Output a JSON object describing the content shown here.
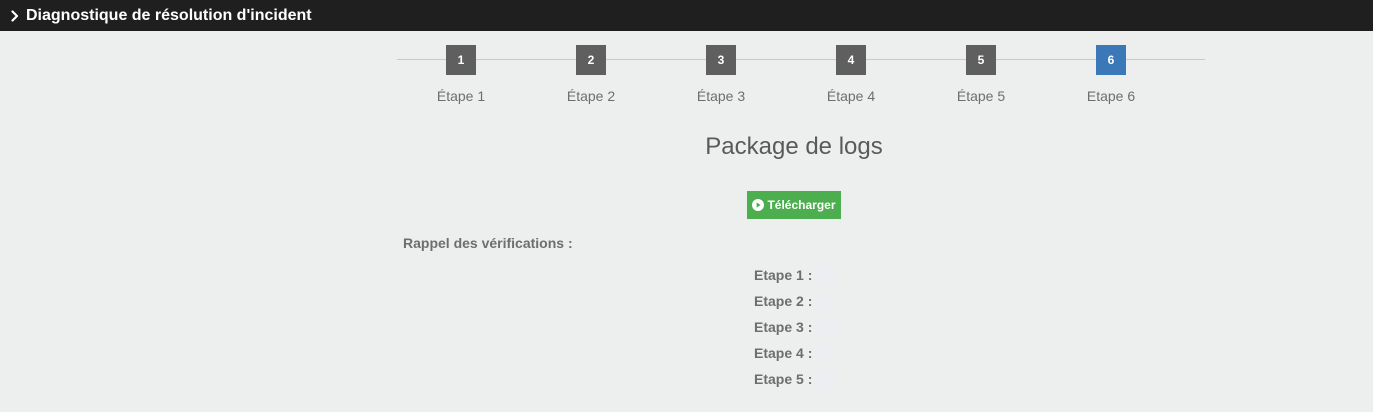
{
  "header": {
    "title": "Diagnostique de résolution d'incident"
  },
  "stepper": {
    "steps": [
      {
        "number": "1",
        "label": "Étape 1",
        "active": false
      },
      {
        "number": "2",
        "label": "Étape 2",
        "active": false
      },
      {
        "number": "3",
        "label": "Étape 3",
        "active": false
      },
      {
        "number": "4",
        "label": "Étape 4",
        "active": false
      },
      {
        "number": "5",
        "label": "Étape 5",
        "active": false
      },
      {
        "number": "6",
        "label": "Etape 6",
        "active": true
      }
    ]
  },
  "main": {
    "title": "Package de logs",
    "download_label": "Télécharger",
    "recap_label": "Rappel des vérifications :",
    "checks": [
      {
        "label": "Etape 1 :"
      },
      {
        "label": "Etape 2 :"
      },
      {
        "label": "Etape 3 :"
      },
      {
        "label": "Etape 4 :"
      },
      {
        "label": "Etape 5 :"
      }
    ]
  },
  "colors": {
    "header_bg": "#1f1f1f",
    "step_inactive": "#5f5f5f",
    "step_active": "#3a78b8",
    "download_button": "#4cae4f",
    "page_bg": "#edeeee"
  },
  "icons": {
    "header": "chevron-right-icon",
    "download": "play-circle-icon"
  }
}
